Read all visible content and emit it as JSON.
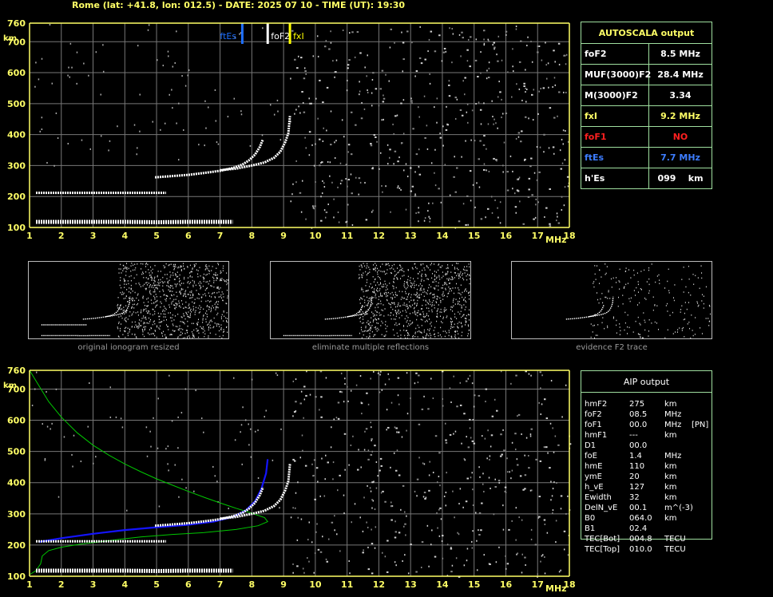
{
  "header": "Rome (lat: +41.8, lon: 012.5) - DATE: 2025 07 10 - TIME (UT): 19:30",
  "colors": {
    "axis": "#ffff66",
    "grid": "#777777",
    "tick_text": "#ffff66",
    "fes": "#1e6fff",
    "fof2": "#ffffff",
    "fxi": "#ffff00",
    "profile": "#00c800",
    "trace": "#1414ff"
  },
  "autoscala": {
    "title": "AUTOSCALA output",
    "rows": [
      {
        "label": "foF2",
        "value": "8.5 MHz",
        "color": "#ffffff"
      },
      {
        "label": "MUF(3000)F2",
        "value": "28.4 MHz",
        "color": "#ffffff"
      },
      {
        "label": "M(3000)F2",
        "value": "3.34",
        "color": "#ffffff"
      },
      {
        "label": "fxI",
        "value": "9.2 MHz",
        "color": "#ffff66"
      },
      {
        "label": "foF1",
        "value": "NO",
        "color": "#ff2020"
      },
      {
        "label": "ftEs",
        "value": "7.7 MHz",
        "color": "#3d7dff"
      },
      {
        "label": "h'Es",
        "value": "099    km",
        "color": "#ffffff"
      }
    ]
  },
  "aip": {
    "title": "AIP output",
    "rows": [
      [
        "hmF2",
        "275",
        "km",
        ""
      ],
      [
        "foF2",
        "08.5",
        "MHz",
        ""
      ],
      [
        "foF1",
        "00.0",
        "MHz",
        "[PN]"
      ],
      [
        "hmF1",
        "---",
        "km",
        ""
      ],
      [
        "D1",
        "00.0",
        "",
        ""
      ],
      [
        "foE",
        "1.4",
        "MHz",
        ""
      ],
      [
        "hmE",
        "110",
        "km",
        ""
      ],
      [
        "ymE",
        "20",
        "km",
        ""
      ],
      [
        "h_vE",
        "127",
        "km",
        ""
      ],
      [
        "Ewidth",
        "32",
        "km",
        ""
      ],
      [
        "DelN_vE",
        "00.1",
        "m^(-3)",
        ""
      ],
      [
        "B0",
        "064.0",
        "km",
        ""
      ],
      [
        "B1",
        "02.4",
        "",
        ""
      ],
      [
        "TEC[Bot]",
        "004.8",
        "TECU",
        ""
      ],
      [
        "TEC[Top]",
        "010.0",
        "TECU",
        ""
      ]
    ]
  },
  "captions": [
    "original ionogram resized",
    "eliminate multiple reflections",
    "evidence F2 trace"
  ],
  "chart_data": [
    {
      "type": "scatter",
      "title": "",
      "xlabel": "MHz",
      "ylabel": "km",
      "xlim": [
        1,
        18
      ],
      "ylim": [
        100,
        760
      ],
      "xticks": [
        1,
        2,
        3,
        4,
        5,
        6,
        7,
        8,
        9,
        10,
        11,
        12,
        13,
        14,
        15,
        16,
        17,
        18
      ],
      "yticks": [
        100,
        200,
        300,
        400,
        500,
        600,
        700,
        760
      ],
      "grid": true,
      "markers": [
        {
          "name": "ftEs",
          "x": 7.7,
          "color": "#1e6fff"
        },
        {
          "name": "foF2",
          "x": 8.5,
          "color": "#ffffff"
        },
        {
          "name": "fxI",
          "x": 9.2,
          "color": "#ffff00"
        }
      ],
      "series": [
        {
          "name": "o-trace",
          "points": [
            [
              4.95,
              262
            ],
            [
              5.5,
              266
            ],
            [
              6.0,
              270
            ],
            [
              6.5,
              276
            ],
            [
              7.0,
              283
            ],
            [
              7.4,
              292
            ],
            [
              7.7,
              303
            ],
            [
              7.9,
              316
            ],
            [
              8.1,
              335
            ],
            [
              8.25,
              360
            ],
            [
              8.35,
              385
            ]
          ]
        },
        {
          "name": "x-trace",
          "points": [
            [
              7.0,
              285
            ],
            [
              7.5,
              290
            ],
            [
              8.0,
              300
            ],
            [
              8.4,
              310
            ],
            [
              8.7,
              325
            ],
            [
              8.9,
              345
            ],
            [
              9.05,
              375
            ],
            [
              9.15,
              405
            ],
            [
              9.2,
              460
            ]
          ]
        },
        {
          "name": "Es",
          "points": [
            [
              1.2,
              118
            ],
            [
              2,
              118
            ],
            [
              3,
              118
            ],
            [
              4,
              118
            ],
            [
              5,
              117
            ],
            [
              6,
              118
            ],
            [
              7.4,
              118
            ]
          ]
        },
        {
          "name": "E-multiple",
          "points": [
            [
              1.2,
              212
            ],
            [
              2,
              212
            ],
            [
              3,
              212
            ],
            [
              4,
              212
            ],
            [
              5,
              212
            ],
            [
              5.3,
              212
            ]
          ]
        }
      ]
    },
    {
      "type": "line",
      "title": "",
      "xlabel": "MHz",
      "ylabel": "km",
      "xlim": [
        1,
        18
      ],
      "ylim": [
        100,
        760
      ],
      "xticks": [
        1,
        2,
        3,
        4,
        5,
        6,
        7,
        8,
        9,
        10,
        11,
        12,
        13,
        14,
        15,
        16,
        17,
        18
      ],
      "yticks": [
        100,
        200,
        300,
        400,
        500,
        600,
        700,
        760
      ],
      "grid": true,
      "series": [
        {
          "name": "profile",
          "color": "#00c800",
          "points": [
            [
              1.0,
              760
            ],
            [
              1.3,
              710
            ],
            [
              1.6,
              660
            ],
            [
              2.0,
              610
            ],
            [
              2.5,
              560
            ],
            [
              3.0,
              520
            ],
            [
              3.5,
              488
            ],
            [
              4.0,
              460
            ],
            [
              4.5,
              435
            ],
            [
              5.0,
              412
            ],
            [
              5.5,
              392
            ],
            [
              6.0,
              372
            ],
            [
              6.5,
              353
            ],
            [
              7.0,
              335
            ],
            [
              7.5,
              318
            ],
            [
              8.0,
              302
            ],
            [
              8.4,
              288
            ],
            [
              8.5,
              275
            ],
            [
              8.2,
              262
            ],
            [
              7.5,
              250
            ],
            [
              6.5,
              240
            ],
            [
              5.5,
              234
            ],
            [
              4.5,
              226
            ],
            [
              3.8,
              218
            ],
            [
              3.2,
              210
            ],
            [
              2.6,
              203
            ],
            [
              2.0,
              193
            ],
            [
              1.6,
              182
            ],
            [
              1.4,
              165
            ],
            [
              1.35,
              140
            ],
            [
              1.2,
              118
            ],
            [
              1.0,
              105
            ]
          ]
        },
        {
          "name": "trace",
          "color": "#1414ff",
          "points": [
            [
              1.3,
              210
            ],
            [
              2.0,
              222
            ],
            [
              3.0,
              236
            ],
            [
              4.0,
              248
            ],
            [
              5.0,
              257
            ],
            [
              6.0,
              265
            ],
            [
              6.8,
              275
            ],
            [
              7.4,
              290
            ],
            [
              7.8,
              310
            ],
            [
              8.1,
              340
            ],
            [
              8.3,
              380
            ],
            [
              8.45,
              430
            ],
            [
              8.5,
              475
            ]
          ]
        }
      ]
    }
  ]
}
